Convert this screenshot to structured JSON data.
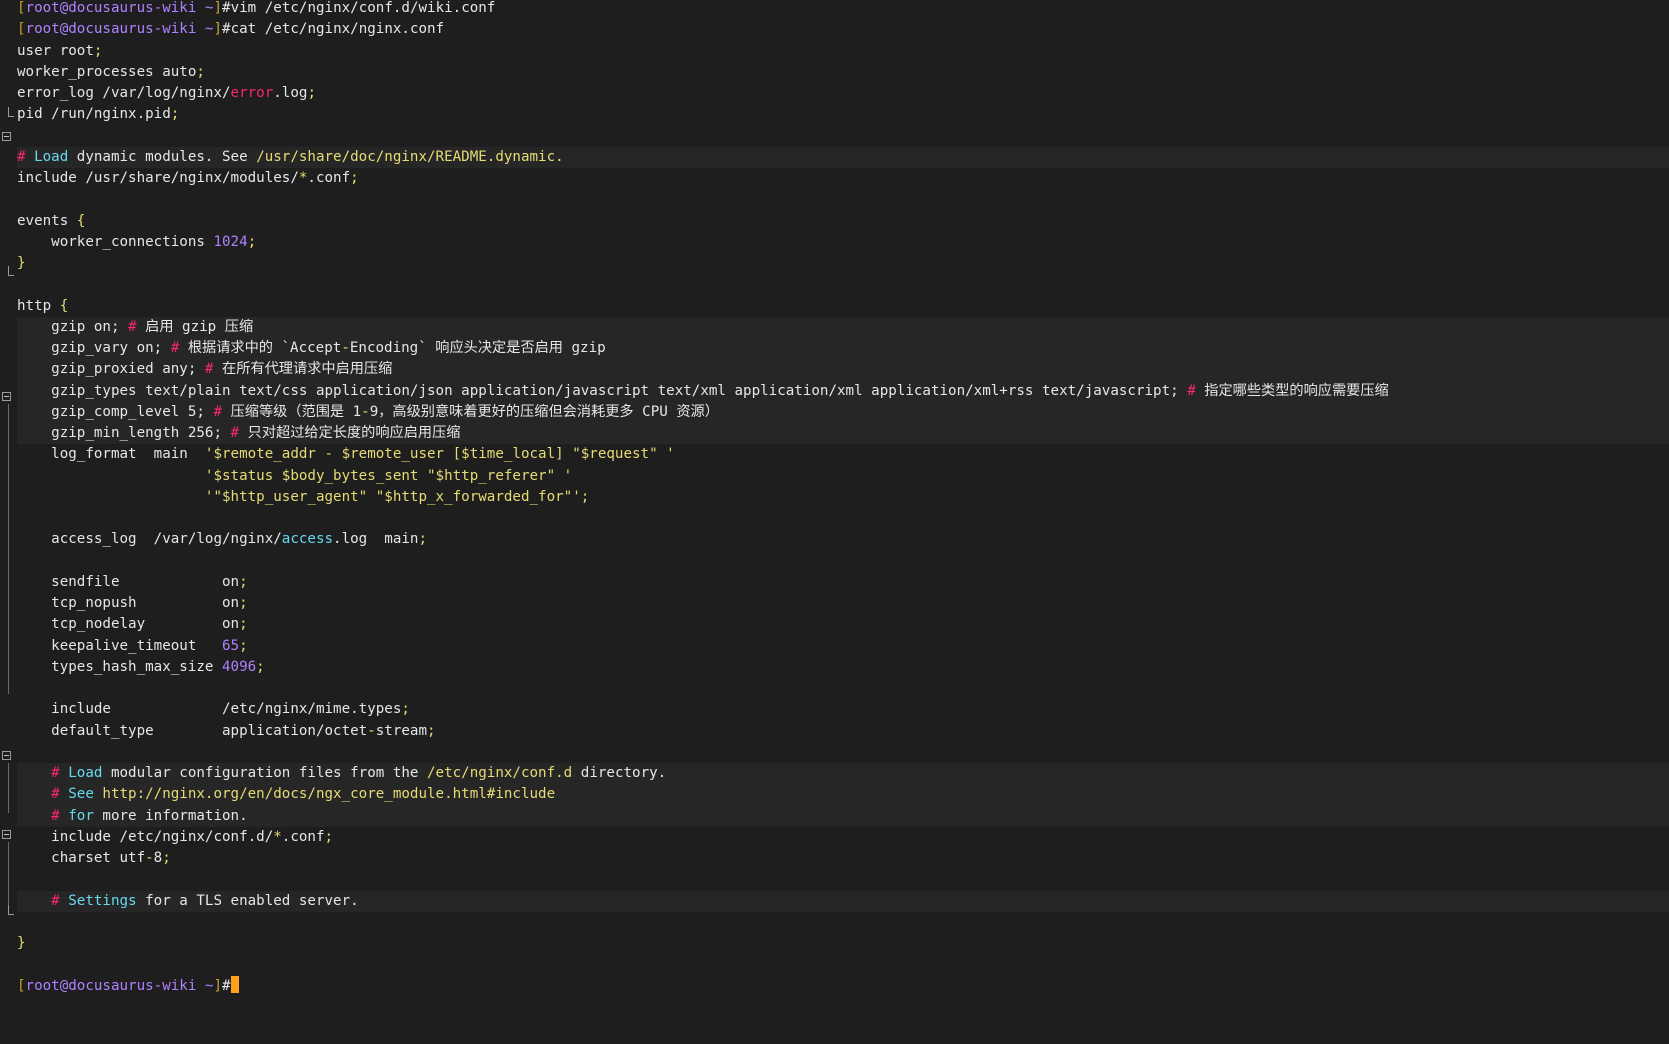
{
  "terminal": {
    "prompt": {
      "user_host": "root@docusaurus-wiki",
      "cwd": "~",
      "symbol": "#"
    },
    "lines": [
      {
        "id": "l0",
        "hl": false,
        "segs": [
          [
            "t-prompt-br",
            "["
          ],
          [
            "t-prompt-user",
            "root@docusaurus-wiki"
          ],
          [
            "t-prompt-tilde",
            " ~"
          ],
          [
            "t-prompt-br",
            "]"
          ],
          [
            "t-default",
            "#vim /etc/nginx/conf.d/wiki.conf"
          ]
        ]
      },
      {
        "id": "l1",
        "hl": false,
        "segs": [
          [
            "t-prompt-br",
            "["
          ],
          [
            "t-prompt-user",
            "root@docusaurus-wiki"
          ],
          [
            "t-prompt-tilde",
            " ~"
          ],
          [
            "t-prompt-br",
            "]"
          ],
          [
            "t-default",
            "#cat /etc/nginx/nginx.conf"
          ]
        ]
      },
      {
        "id": "l2",
        "hl": false,
        "segs": [
          [
            "t-default",
            "user root"
          ],
          [
            "t-punct",
            ";"
          ]
        ]
      },
      {
        "id": "l3",
        "hl": false,
        "segs": [
          [
            "t-default",
            "worker_processes auto"
          ],
          [
            "t-punct",
            ";"
          ]
        ]
      },
      {
        "id": "l4",
        "hl": false,
        "segs": [
          [
            "t-default",
            "error_log /var/log/nginx/"
          ],
          [
            "t-error",
            "error"
          ],
          [
            "t-default",
            ".log"
          ],
          [
            "t-punct",
            ";"
          ]
        ]
      },
      {
        "id": "l5",
        "hl": false,
        "segs": [
          [
            "t-default",
            "pid /run/nginx.pid"
          ],
          [
            "t-punct",
            ";"
          ]
        ]
      },
      {
        "id": "l6",
        "hl": false,
        "segs": []
      },
      {
        "id": "l7",
        "hl": true,
        "segs": [
          [
            "t-comment",
            "# "
          ],
          [
            "t-keyword",
            "Load"
          ],
          [
            "t-default",
            " dynamic modules. See "
          ],
          [
            "t-path",
            "/usr/share/doc/nginx/README.dynamic."
          ]
        ]
      },
      {
        "id": "l8",
        "hl": false,
        "segs": [
          [
            "t-default",
            "include /usr/share/nginx/modules/"
          ],
          [
            "t-punct",
            "*"
          ],
          [
            "t-default",
            ".conf"
          ],
          [
            "t-punct",
            ";"
          ]
        ]
      },
      {
        "id": "l9",
        "hl": false,
        "segs": []
      },
      {
        "id": "l10",
        "hl": false,
        "segs": [
          [
            "t-default",
            "events "
          ],
          [
            "t-punct",
            "{"
          ]
        ]
      },
      {
        "id": "l11",
        "hl": false,
        "segs": [
          [
            "t-default",
            "    worker_connections "
          ],
          [
            "t-number",
            "1024"
          ],
          [
            "t-punct",
            ";"
          ]
        ]
      },
      {
        "id": "l12",
        "hl": false,
        "segs": [
          [
            "t-punct",
            "}"
          ]
        ]
      },
      {
        "id": "l13",
        "hl": false,
        "segs": []
      },
      {
        "id": "l14",
        "hl": false,
        "segs": [
          [
            "t-default",
            "http "
          ],
          [
            "t-punct",
            "{"
          ]
        ]
      },
      {
        "id": "l15",
        "hl": true,
        "segs": [
          [
            "t-default",
            "    gzip on; "
          ],
          [
            "t-comment",
            "# "
          ],
          [
            "t-default",
            "启用 gzip 压缩"
          ]
        ]
      },
      {
        "id": "l16",
        "hl": true,
        "segs": [
          [
            "t-default",
            "    gzip_vary on; "
          ],
          [
            "t-comment",
            "# "
          ],
          [
            "t-default",
            "根据请求中的 `Accept"
          ],
          [
            "t-punct",
            "-"
          ],
          [
            "t-default",
            "Encoding` 响应头决定是否启用 gzip"
          ]
        ]
      },
      {
        "id": "l17",
        "hl": true,
        "segs": [
          [
            "t-default",
            "    gzip_proxied any; "
          ],
          [
            "t-comment",
            "# "
          ],
          [
            "t-default",
            "在所有代理请求中启用压缩"
          ]
        ]
      },
      {
        "id": "l18",
        "hl": true,
        "segs": [
          [
            "t-default",
            "    gzip_types text/plain text/css application/json application/javascript text/xml application/xml application/xml+rss text/javascript; "
          ],
          [
            "t-comment",
            "# "
          ],
          [
            "t-default",
            "指定哪些类型的响应需要压缩"
          ]
        ]
      },
      {
        "id": "l19",
        "hl": true,
        "segs": [
          [
            "t-default",
            "    gzip_comp_level 5; "
          ],
          [
            "t-comment",
            "# "
          ],
          [
            "t-default",
            "压缩等级（范围是 1"
          ],
          [
            "t-punct",
            "-"
          ],
          [
            "t-default",
            "9，高级别意味着更好的压缩但会消耗更多 CPU 资源）"
          ]
        ]
      },
      {
        "id": "l20",
        "hl": true,
        "segs": [
          [
            "t-default",
            "    gzip_min_length 256; "
          ],
          [
            "t-comment",
            "# "
          ],
          [
            "t-default",
            "只对超过给定长度的响应启用压缩"
          ]
        ]
      },
      {
        "id": "l21",
        "hl": false,
        "segs": [
          [
            "t-default",
            "    log_format  main  "
          ],
          [
            "t-string",
            "'$remote_addr - $remote_user [$time_local] \"$request\" '"
          ]
        ]
      },
      {
        "id": "l22",
        "hl": false,
        "segs": [
          [
            "t-default",
            "                      "
          ],
          [
            "t-string",
            "'$status $body_bytes_sent \"$http_referer\" '"
          ]
        ]
      },
      {
        "id": "l23",
        "hl": false,
        "segs": [
          [
            "t-default",
            "                      "
          ],
          [
            "t-string",
            "'\"$http_user_agent\" \"$http_x_forwarded_for\"';"
          ]
        ]
      },
      {
        "id": "l24",
        "hl": false,
        "segs": []
      },
      {
        "id": "l25",
        "hl": false,
        "segs": [
          [
            "t-default",
            "    access_log  /var/log/nginx/"
          ],
          [
            "t-keyword",
            "access"
          ],
          [
            "t-default",
            ".log  main"
          ],
          [
            "t-punct",
            ";"
          ]
        ]
      },
      {
        "id": "l26",
        "hl": false,
        "segs": []
      },
      {
        "id": "l27",
        "hl": false,
        "segs": [
          [
            "t-default",
            "    sendfile            on"
          ],
          [
            "t-punct",
            ";"
          ]
        ]
      },
      {
        "id": "l28",
        "hl": false,
        "segs": [
          [
            "t-default",
            "    tcp_nopush          on"
          ],
          [
            "t-punct",
            ";"
          ]
        ]
      },
      {
        "id": "l29",
        "hl": false,
        "segs": [
          [
            "t-default",
            "    tcp_nodelay         on"
          ],
          [
            "t-punct",
            ";"
          ]
        ]
      },
      {
        "id": "l30",
        "hl": false,
        "segs": [
          [
            "t-default",
            "    keepalive_timeout   "
          ],
          [
            "t-number",
            "65"
          ],
          [
            "t-punct",
            ";"
          ]
        ]
      },
      {
        "id": "l31",
        "hl": false,
        "segs": [
          [
            "t-default",
            "    types_hash_max_size "
          ],
          [
            "t-number",
            "4096"
          ],
          [
            "t-punct",
            ";"
          ]
        ]
      },
      {
        "id": "l32",
        "hl": false,
        "segs": []
      },
      {
        "id": "l33",
        "hl": false,
        "segs": [
          [
            "t-default",
            "    include             /etc/nginx/mime.types"
          ],
          [
            "t-punct",
            ";"
          ]
        ]
      },
      {
        "id": "l34",
        "hl": false,
        "segs": [
          [
            "t-default",
            "    default_type        application/octet"
          ],
          [
            "t-punct",
            "-"
          ],
          [
            "t-default",
            "stream"
          ],
          [
            "t-punct",
            ";"
          ]
        ]
      },
      {
        "id": "l35",
        "hl": false,
        "segs": []
      },
      {
        "id": "l36",
        "hl": true,
        "segs": [
          [
            "t-comment",
            "    # "
          ],
          [
            "t-keyword",
            "Load"
          ],
          [
            "t-default",
            " modular configuration files from the "
          ],
          [
            "t-path",
            "/etc/nginx/conf.d"
          ],
          [
            "t-default",
            " directory."
          ]
        ]
      },
      {
        "id": "l37",
        "hl": true,
        "segs": [
          [
            "t-comment",
            "    # "
          ],
          [
            "t-keyword",
            "See"
          ],
          [
            "t-default",
            " "
          ],
          [
            "t-path",
            "http://nginx.org/en/docs/ngx_core_module.html#include"
          ]
        ]
      },
      {
        "id": "l38",
        "hl": true,
        "segs": [
          [
            "t-comment",
            "    # "
          ],
          [
            "t-keyword",
            "for"
          ],
          [
            "t-default",
            " more information."
          ]
        ]
      },
      {
        "id": "l39",
        "hl": false,
        "segs": [
          [
            "t-default",
            "    include /etc/nginx/conf.d/"
          ],
          [
            "t-punct",
            "*"
          ],
          [
            "t-default",
            ".conf"
          ],
          [
            "t-punct",
            ";"
          ]
        ]
      },
      {
        "id": "l40",
        "hl": false,
        "segs": [
          [
            "t-default",
            "    charset utf"
          ],
          [
            "t-punct",
            "-"
          ],
          [
            "t-default",
            "8"
          ],
          [
            "t-punct",
            ";"
          ]
        ]
      },
      {
        "id": "l41",
        "hl": false,
        "segs": []
      },
      {
        "id": "l42",
        "hl": true,
        "segs": [
          [
            "t-comment",
            "    # "
          ],
          [
            "t-keyword",
            "Settings"
          ],
          [
            "t-default",
            " for a TLS enabled server."
          ]
        ]
      },
      {
        "id": "l43",
        "hl": false,
        "segs": []
      },
      {
        "id": "l44",
        "hl": false,
        "segs": [
          [
            "t-punct",
            "}"
          ]
        ]
      },
      {
        "id": "l45",
        "hl": false,
        "segs": []
      },
      {
        "id": "l46",
        "hl": false,
        "prompt": true,
        "segs": [
          [
            "t-prompt-br",
            "["
          ],
          [
            "t-prompt-user",
            "root@docusaurus-wiki"
          ],
          [
            "t-prompt-tilde",
            " ~"
          ],
          [
            "t-prompt-br",
            "]"
          ],
          [
            "t-default",
            "#"
          ]
        ]
      }
    ],
    "cursor_color": "#ff9f1a",
    "background": "#1e1e1e"
  }
}
